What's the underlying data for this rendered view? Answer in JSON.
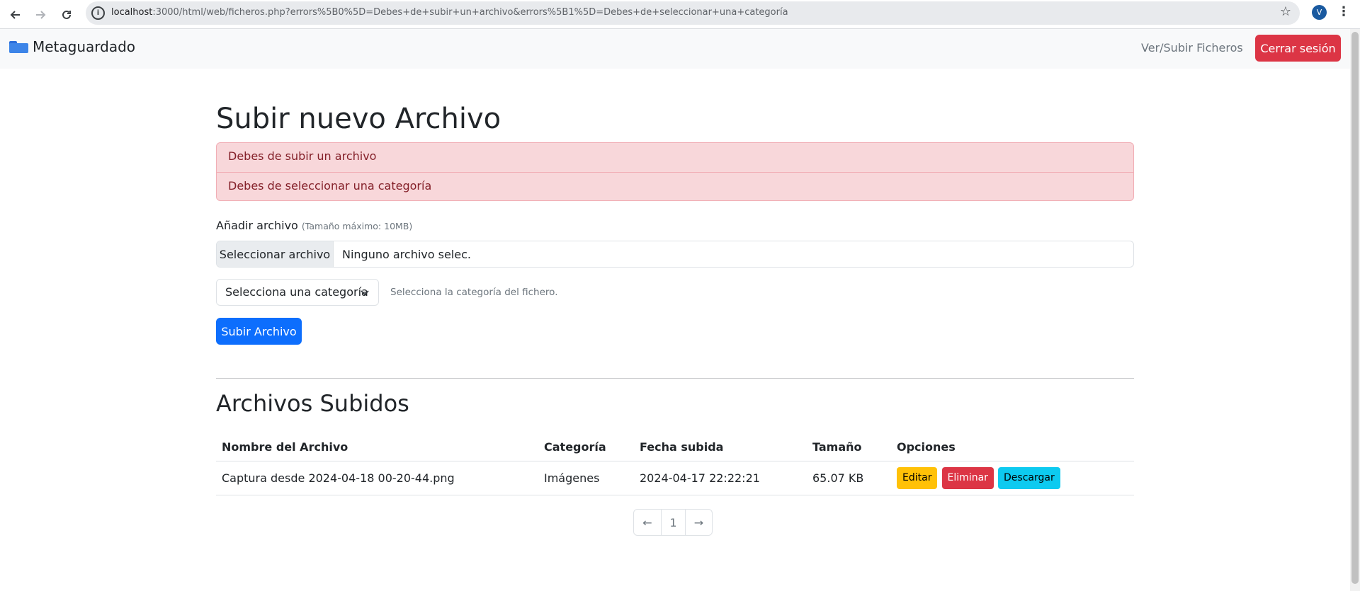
{
  "browser": {
    "back_icon": "arrow-left-icon",
    "forward_icon": "arrow-right-icon",
    "reload_icon": "reload-icon",
    "url_host": "localhost",
    "url_rest": ":3000/html/web/ficheros.php?errors%5B0%5D=Debes+de+subir+un+archivo&errors%5B1%5D=Debes+de+seleccionar+una+categoría",
    "profile_initial": "V"
  },
  "navbar": {
    "brand": "Metaguardado",
    "link": "Ver/Subir Ficheros",
    "logout": "Cerrar sesión"
  },
  "upload": {
    "title": "Subir nuevo Archivo",
    "errors": [
      "Debes de subir un archivo",
      "Debes de seleccionar una categoría"
    ],
    "file_label": "Añadir archivo",
    "file_hint": "(Tamaño máximo: 10MB)",
    "file_button": "Seleccionar archivo",
    "file_value": "Ninguno archivo selec.",
    "category_selected": "Selecciona una categoría",
    "category_help": "Selecciona la categoría del fichero.",
    "submit": "Subir Archivo"
  },
  "files": {
    "title": "Archivos Subidos",
    "columns": [
      "Nombre del Archivo",
      "Categoría",
      "Fecha subida",
      "Tamaño",
      "Opciones"
    ],
    "rows": [
      {
        "name": "Captura desde 2024-04-18 00-20-44.png",
        "category": "Imágenes",
        "date": "2024-04-17 22:22:21",
        "size": "65.07 KB",
        "edit": "Editar",
        "delete": "Eliminar",
        "download": "Descargar"
      }
    ]
  },
  "pagination": {
    "prev": "←",
    "page": "1",
    "next": "→"
  },
  "colors": {
    "danger": "#dc3545",
    "primary": "#0d6efd",
    "warning": "#ffc107",
    "info": "#0dcaf0"
  }
}
